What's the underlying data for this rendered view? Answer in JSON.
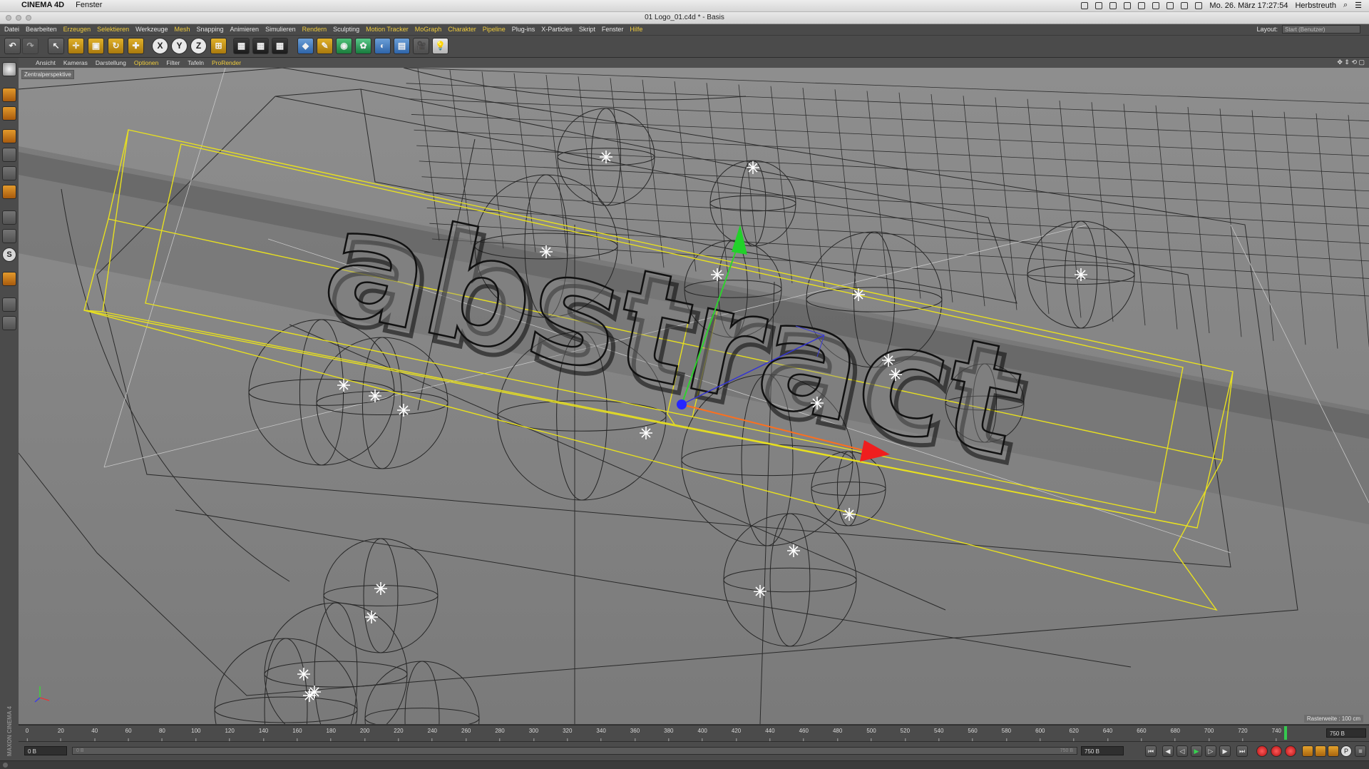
{
  "mac_menubar": {
    "apple": "",
    "app_name": "CINEMA 4D",
    "menu": "Fenster",
    "clock": "Mo. 26. März  17:27:54",
    "user": "Herbstreuth"
  },
  "window": {
    "title": "01 Logo_01.c4d * - Basis"
  },
  "app_menu": {
    "items": [
      "Datei",
      "Bearbeiten",
      "Erzeugen",
      "Selektieren",
      "Werkzeuge",
      "Mesh",
      "Snapping",
      "Animieren",
      "Simulieren",
      "Rendern",
      "Sculpting",
      "Motion Tracker",
      "MoGraph",
      "Charakter",
      "Pipeline",
      "Plug-ins",
      "X-Particles",
      "Skript",
      "Fenster",
      "Hilfe"
    ],
    "layout_label": "Layout:",
    "layout_value": "Start (Benutzer)"
  },
  "toolbar": {
    "axis_x": "X",
    "axis_y": "Y",
    "axis_z": "Z"
  },
  "viewport_menu": {
    "items": [
      "Ansicht",
      "Kameras",
      "Darstellung",
      "Optionen",
      "Filter",
      "Tafeln",
      "ProRender"
    ],
    "nav_icons": "✥ ⇕ ⟲ ▢"
  },
  "viewport": {
    "camera_label": "Zentralperspektive",
    "grid_info": "Rasterweite : 100 cm",
    "text_object": "abstract"
  },
  "timeline": {
    "ticks": [
      "0",
      "20",
      "40",
      "60",
      "80",
      "100",
      "120",
      "140",
      "160",
      "180",
      "200",
      "220",
      "240",
      "260",
      "280",
      "300",
      "320",
      "340",
      "360",
      "380",
      "400",
      "420",
      "440",
      "460",
      "480",
      "500",
      "520",
      "540",
      "560",
      "580",
      "600",
      "620",
      "640",
      "660",
      "680",
      "700",
      "720",
      "740"
    ],
    "end_frame": "750 B",
    "playhead_fraction": 0.995
  },
  "transport": {
    "current_frame": "0 B",
    "slider_min": "0 B",
    "slider_max": "750 B",
    "end_field": "750 B",
    "max_field": "750 B"
  },
  "branding": {
    "logo_text": "MAXON CINEMA 4D"
  }
}
